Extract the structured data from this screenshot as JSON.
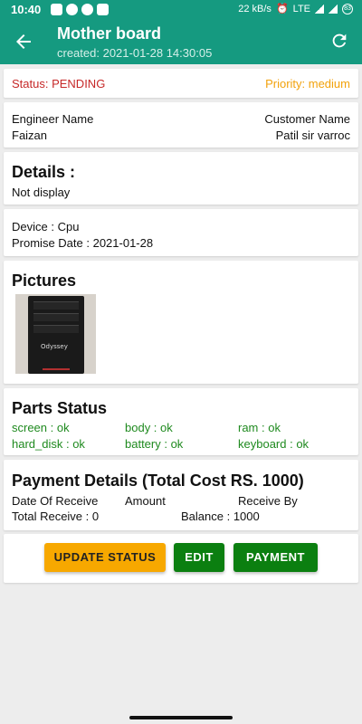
{
  "statusbar": {
    "time": "10:40",
    "network_speed": "22 kB/s",
    "network_type": "LTE",
    "battery": "83"
  },
  "appbar": {
    "title": "Mother board",
    "subtitle": "created: 2021-01-28 14:30:05"
  },
  "status": {
    "status_text": "Status: PENDING",
    "priority_text": "Priority: medium",
    "colors": {
      "status": "#c62828",
      "priority": "#f2a20c"
    }
  },
  "people": {
    "engineer_label": "Engineer Name",
    "engineer_value": "Faizan",
    "customer_label": "Customer Name",
    "customer_value": "Patil sir varroc"
  },
  "details": {
    "heading": "Details :",
    "text": "Not display"
  },
  "device": {
    "device_line": "Device : Cpu",
    "promise_line": "Promise Date : 2021-01-28"
  },
  "pictures": {
    "heading": "Pictures",
    "photo_brand_text": "Odyssey"
  },
  "parts": {
    "heading": "Parts Status",
    "items": [
      "screen : ok",
      "body : ok",
      "ram : ok",
      "hard_disk : ok",
      "battery : ok",
      "keyboard : ok"
    ],
    "color": "#1f8a1f"
  },
  "payment": {
    "heading": "Payment Details (Total Cost RS. 1000)",
    "date_label": "Date Of Receive",
    "amount_label": "Amount",
    "receive_by_label": "Receive By",
    "total_receive": "Total Receive : 0",
    "balance": "Balance : 1000"
  },
  "actions": {
    "update_status": "UPDATE STATUS",
    "edit": "EDIT",
    "payment": "PAYMENT",
    "colors": {
      "update": "#f7a800",
      "edit": "#0b7f10",
      "payment": "#0b7f10"
    }
  },
  "theme": {
    "primary": "#159a80"
  }
}
